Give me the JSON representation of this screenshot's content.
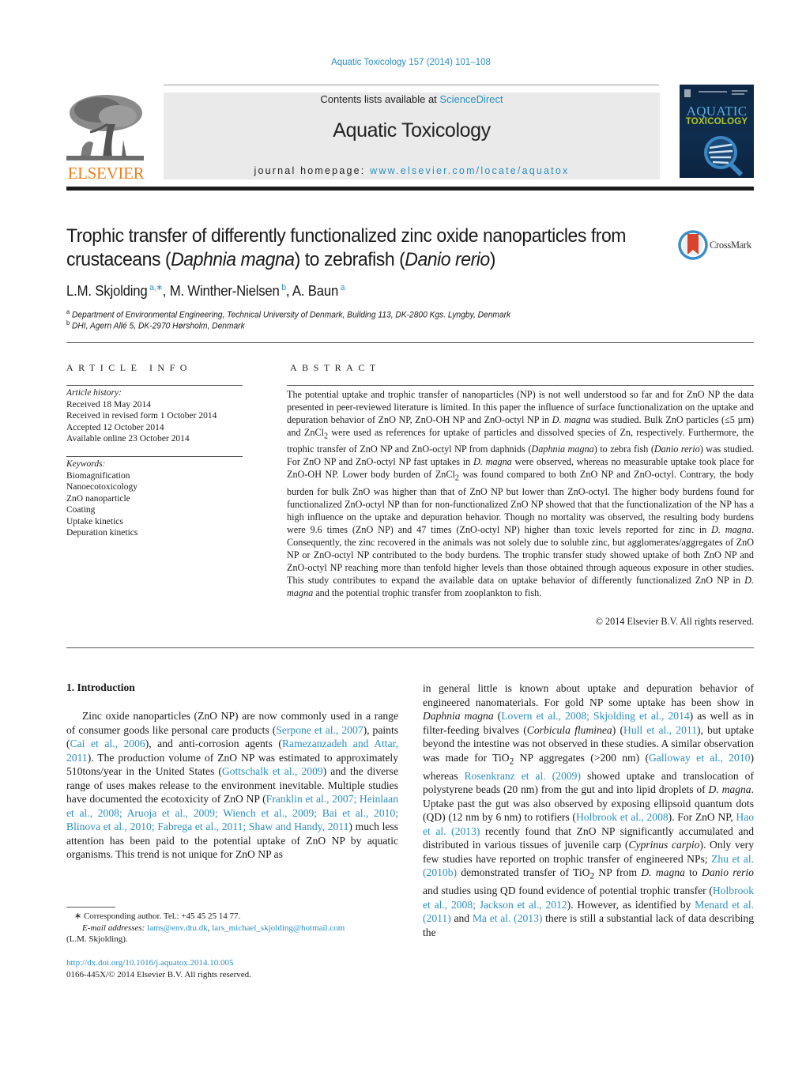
{
  "header": {
    "citation": "Aquatic Toxicology 157 (2014) 101–108",
    "contents_prefix": "Contents lists available at ",
    "contents_link": "ScienceDirect",
    "journal_title": "Aquatic Toxicology",
    "homepage_prefix": "journal homepage: ",
    "homepage_link": "www.elsevier.com/locate/aquatox",
    "publisher_logo_text": "ELSEVIER",
    "cover": {
      "line1": "AQUATIC",
      "line2": "TOXICOLOGY"
    },
    "colors": {
      "link": "#2b8fc4",
      "elsevier_orange": "#f07d1a",
      "banner_grey": "#eaeaea",
      "cover_navy": "#0f2d4e",
      "cover_green": "#b3c830"
    }
  },
  "article": {
    "title_part1": "Trophic transfer of differently functionalized zinc oxide nanoparticles from crustaceans (",
    "title_italic1": "Daphnia magna",
    "title_part2": ") to zebrafish (",
    "title_italic2": "Danio rerio",
    "title_part3": ")",
    "crossmark_label": "CrossMark",
    "authors": [
      {
        "name": "L.M. Skjolding",
        "sup": "a,∗",
        "sep": ", "
      },
      {
        "name": "M. Winther-Nielsen",
        "sup": "b",
        "sep": ", "
      },
      {
        "name": "A. Baun",
        "sup": "a",
        "sep": ""
      }
    ],
    "affiliations": [
      {
        "mark": "a",
        "text": "Department of Environmental Engineering, Technical University of Denmark, Building 113, DK-2800 Kgs. Lyngby, Denmark"
      },
      {
        "mark": "b",
        "text": "DHI, Agern Allé 5, DK-2970 Hørsholm, Denmark"
      }
    ]
  },
  "article_info": {
    "heading": "ARTICLE INFO",
    "history_label": "Article history:",
    "history": [
      "Received 18 May 2014",
      "Received in revised form 1 October 2014",
      "Accepted 12 October 2014",
      "Available online 23 October 2014"
    ],
    "keywords_label": "Keywords:",
    "keywords": [
      "Biomagnification",
      "Nanoecotoxicology",
      "ZnO nanoparticle",
      "Coating",
      "Uptake kinetics",
      "Depuration kinetics"
    ]
  },
  "abstract": {
    "heading": "ABSTRACT",
    "segments": [
      {
        "t": "The potential uptake and trophic transfer of nanoparticles (NP) is not well understood so far and for ZnO NP the data presented in peer-reviewed literature is limited. In this paper the influence of surface functionalization on the uptake and depuration behavior of ZnO NP, ZnO-OH NP and ZnO-octyl NP in "
      },
      {
        "t": "D. magna",
        "i": true
      },
      {
        "t": " was studied. Bulk ZnO particles (≤5 µm) and ZnCl"
      },
      {
        "t": "2",
        "sub": true
      },
      {
        "t": " were used as references for uptake of particles and dissolved species of Zn, respectively. Furthermore, the trophic transfer of ZnO NP and ZnO-octyl NP from daphnids ("
      },
      {
        "t": "Daphnia magna",
        "i": true
      },
      {
        "t": ") to zebra fish ("
      },
      {
        "t": "Danio rerio",
        "i": true
      },
      {
        "t": ") was studied. For ZnO NP and ZnO-octyl NP fast uptakes in "
      },
      {
        "t": "D. magna",
        "i": true
      },
      {
        "t": " were observed, whereas no measurable uptake took place for ZnO-OH NP. Lower body burden of ZnCl"
      },
      {
        "t": "2",
        "sub": true
      },
      {
        "t": " was found compared to both ZnO NP and ZnO-octyl. Contrary, the body burden for bulk ZnO was higher than that of ZnO NP but lower than ZnO-octyl. The higher body burdens found for functionalized ZnO-octyl NP than for non-functionalized ZnO NP showed that that the functionalization of the NP has a high influence on the uptake and depuration behavior. Though no mortality was observed, the resulting body burdens were 9.6 times (ZnO NP) and 47 times (ZnO-octyl NP) higher than toxic levels reported for zinc in "
      },
      {
        "t": "D. magna",
        "i": true
      },
      {
        "t": ". Consequently, the zinc recovered in the animals was not solely due to soluble zinc, but agglomerates/aggregates of ZnO NP or ZnO-octyl NP contributed to the body burdens. The trophic transfer study showed uptake of both ZnO NP and ZnO-octyl NP reaching more than tenfold higher levels than those obtained through aqueous exposure in other studies. This study contributes to expand the available data on uptake behavior of differently functionalized ZnO NP in "
      },
      {
        "t": "D. magna",
        "i": true
      },
      {
        "t": " and the potential trophic transfer from zooplankton to fish."
      }
    ],
    "copyright": "© 2014 Elsevier B.V. All rights reserved."
  },
  "introduction": {
    "heading": "1.  Introduction",
    "left_segments": [
      {
        "t": "Zinc oxide nanoparticles (ZnO NP) are now commonly used in a range of consumer goods like personal care products ("
      },
      {
        "t": "Serpone et al., 2007",
        "link": true
      },
      {
        "t": "), paints ("
      },
      {
        "t": "Cai et al., 2006",
        "link": true
      },
      {
        "t": "), and anti-corrosion agents ("
      },
      {
        "t": "Ramezanzadeh and Attar, 2011",
        "link": true
      },
      {
        "t": "). The production volume of ZnO NP was estimated to approximately 510tons/year in the United States ("
      },
      {
        "t": "Gottschalk et al., 2009",
        "link": true
      },
      {
        "t": ") and the diverse range of uses makes release to the environment inevitable. Multiple studies have documented the ecotoxicity of ZnO NP ("
      },
      {
        "t": "Franklin et al., 2007; Heinlaan et al., 2008; Aruoja et al., 2009; Wiench et al., 2009; Bai et al., 2010; Blinova et al., 2010; Fabrega et al., 2011; Shaw and Handy, 2011",
        "link": true
      },
      {
        "t": ") much less attention has been paid to the potential uptake of ZnO NP by aquatic organisms. This trend is not unique for ZnO NP as"
      }
    ],
    "right_segments": [
      {
        "t": "in general little is known about uptake and depuration behavior of engineered nanomaterials. For gold NP some uptake has been show in "
      },
      {
        "t": "Daphnia magna",
        "i": true
      },
      {
        "t": " ("
      },
      {
        "t": "Lovern et al., 2008; Skjolding et al., 2014",
        "link": true
      },
      {
        "t": ") as well as in filter-feeding bivalves ("
      },
      {
        "t": "Corbicula fluminea",
        "i": true
      },
      {
        "t": ") ("
      },
      {
        "t": "Hull et al., 2011",
        "link": true
      },
      {
        "t": "), but uptake beyond the intestine was not observed in these studies. A similar observation was made for TiO"
      },
      {
        "t": "2",
        "sub": true
      },
      {
        "t": " NP aggregates (>200 nm) ("
      },
      {
        "t": "Galloway et al., 2010",
        "link": true
      },
      {
        "t": ") whereas "
      },
      {
        "t": "Rosenkranz et al. (2009)",
        "link": true
      },
      {
        "t": " showed uptake and translocation of polystyrene beads (20 nm) from the gut and into lipid droplets of "
      },
      {
        "t": "D. magna",
        "i": true
      },
      {
        "t": ". Uptake past the gut was also observed by exposing ellipsoid quantum dots (QD) (12 nm by 6 nm) to rotifiers ("
      },
      {
        "t": "Holbrook et al., 2008",
        "link": true
      },
      {
        "t": "). For ZnO NP, "
      },
      {
        "t": "Hao et al. (2013)",
        "link": true
      },
      {
        "t": " recently found that ZnO NP significantly accumulated and distributed in various tissues of juvenile carp ("
      },
      {
        "t": "Cyprinus carpio",
        "i": true
      },
      {
        "t": "). Only very few studies have reported on trophic transfer of engineered NPs; "
      },
      {
        "t": "Zhu et al. (2010b)",
        "link": true
      },
      {
        "t": " demonstrated transfer of TiO"
      },
      {
        "t": "2",
        "sub": true
      },
      {
        "t": " NP from "
      },
      {
        "t": "D. magna",
        "i": true
      },
      {
        "t": " to "
      },
      {
        "t": "Danio rerio",
        "i": true
      },
      {
        "t": " and studies using QD found evidence of potential trophic transfer ("
      },
      {
        "t": "Holbrook et al., 2008; Jackson et al., 2012",
        "link": true
      },
      {
        "t": "). However, as identified by "
      },
      {
        "t": "Menard et al. (2011)",
        "link": true
      },
      {
        "t": " and "
      },
      {
        "t": "Ma et al. (2013)",
        "link": true
      },
      {
        "t": " there is still a substantial lack of data describing the"
      }
    ]
  },
  "footnote": {
    "corresponding": "∗  Corresponding author. Tel.: +45 45 25 14 77.",
    "email_label": "E-mail addresses: ",
    "emails": [
      "lams@env.dtu.dk",
      "lars_michael_skjolding@hotmail.com"
    ],
    "email_owner": "(L.M. Skjolding).",
    "doi": "http://dx.doi.org/10.1016/j.aquatox.2014.10.005",
    "issn_copyright": "0166-445X/© 2014 Elsevier B.V. All rights reserved."
  }
}
